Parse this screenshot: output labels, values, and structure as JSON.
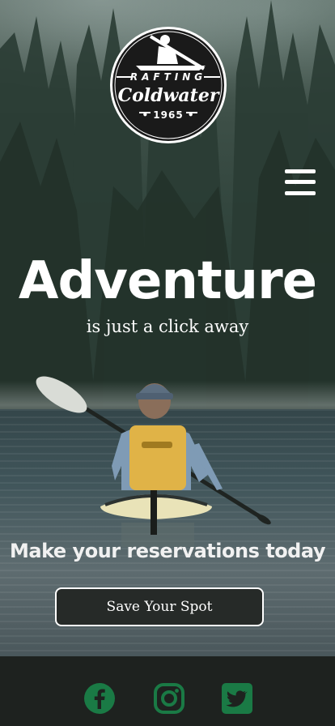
{
  "logo": {
    "top_word": "RAFTING",
    "brand": "Coldwater",
    "year": "• 1965 •"
  },
  "menu": {
    "icon": "hamburger-menu-icon"
  },
  "hero": {
    "headline": "Adventure",
    "subhead": "is just a click away",
    "cta_text": "Make your reservations today",
    "button_label": "Save Your Spot"
  },
  "footer": {
    "social": [
      {
        "name": "facebook-icon"
      },
      {
        "name": "instagram-icon"
      },
      {
        "name": "twitter-icon"
      }
    ],
    "icon_color": "#1a7a45"
  },
  "colors": {
    "button_bg": "#262a28",
    "footer_bg": "#1e221f",
    "text": "#ffffff",
    "life_vest": "#e0b347"
  }
}
